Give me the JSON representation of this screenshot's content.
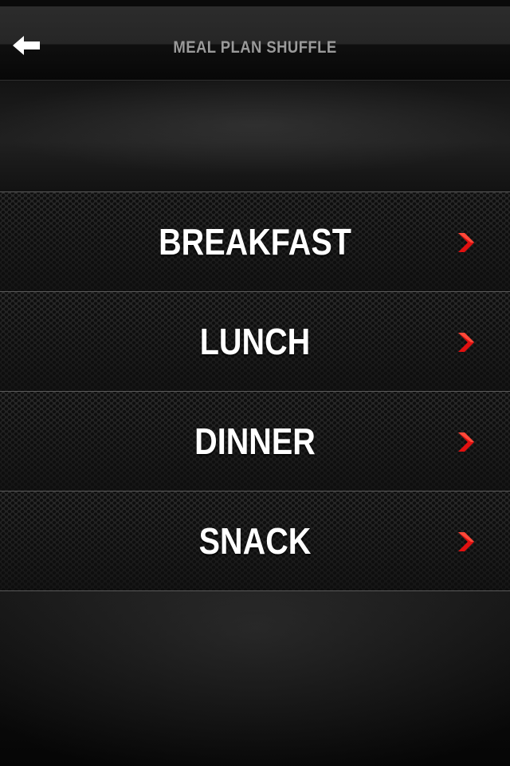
{
  "header": {
    "title": "MEAL PLAN SHUFFLE",
    "back_icon": "back-arrow-icon"
  },
  "menu": {
    "items": [
      {
        "label": "BREAKFAST",
        "icon": "chevron-right-icon"
      },
      {
        "label": "LUNCH",
        "icon": "chevron-right-icon"
      },
      {
        "label": "DINNER",
        "icon": "chevron-right-icon"
      },
      {
        "label": "SNACK",
        "icon": "chevron-right-icon"
      }
    ]
  },
  "colors": {
    "accent": "#e01010",
    "title_text": "#9a9a9a",
    "item_text": "#ffffff",
    "background": "#111111"
  }
}
